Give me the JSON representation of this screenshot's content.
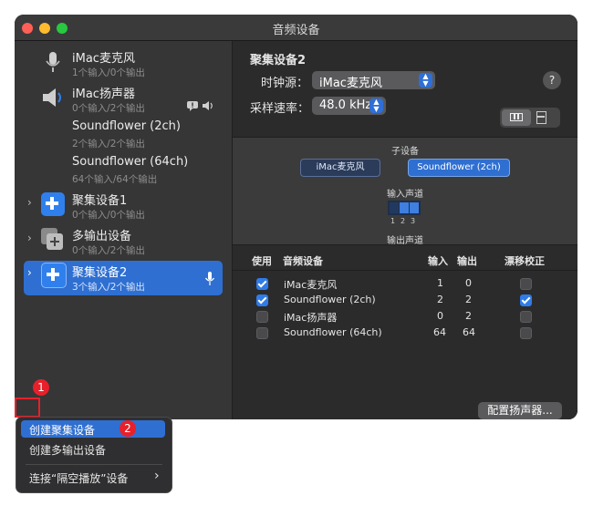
{
  "window": {
    "title": "音频设备"
  },
  "sidebar": {
    "devices": [
      {
        "name": "iMac麦克风",
        "sub": "1个输入/0个输出",
        "icon": "microphone-icon"
      },
      {
        "name": "iMac扬声器",
        "sub": "0个输入/2个输出",
        "icon": "speaker-icon"
      },
      {
        "name": "Soundflower (2ch)",
        "sub": "2个输入/2个输出"
      },
      {
        "name": "Soundflower (64ch)",
        "sub": "64个输入/64个输出"
      },
      {
        "name": "聚集设备1",
        "sub": "0个输入/0个输出",
        "icon": "aggregate-device-icon"
      },
      {
        "name": "多输出设备",
        "sub": "0个输入/2个输出",
        "icon": "multi-output-device-icon"
      },
      {
        "name": "聚集设备2",
        "sub": "3个输入/2个输出",
        "icon": "aggregate-device-icon",
        "selected": true
      }
    ],
    "bottom_bar": {
      "add": "+",
      "remove": "—",
      "gear": "⚙",
      "chevron": "⌄"
    }
  },
  "detail": {
    "device_title": "聚集设备2",
    "clock_label": "时钟源：",
    "clock_value": "iMac麦克风",
    "rate_label": "采样速率：",
    "rate_value": "48.0 kHz",
    "help": "?",
    "diagram": {
      "subdevice_title": "子设备",
      "chips": [
        "iMac麦克风",
        "Soundflower (2ch)"
      ],
      "input_label": "输入声道",
      "channel_numbers": [
        "1",
        "2",
        "3"
      ],
      "output_label": "输出声道"
    },
    "table": {
      "headers": [
        "使用",
        "音频设备",
        "输入",
        "输出",
        "漂移校正"
      ],
      "rows": [
        {
          "use": true,
          "device": "iMac麦克风",
          "in": "1",
          "out": "0",
          "drift": false
        },
        {
          "use": true,
          "device": "Soundflower (2ch)",
          "in": "2",
          "out": "2",
          "drift": true
        },
        {
          "use": false,
          "device": "iMac扬声器",
          "in": "0",
          "out": "2",
          "drift": false
        },
        {
          "use": false,
          "device": "Soundflower (64ch)",
          "in": "64",
          "out": "64",
          "drift": false
        }
      ]
    },
    "configure_button": "配置扬声器..."
  },
  "menu": {
    "items": [
      "创建聚集设备",
      "创建多输出设备",
      "连接“隔空播放”设备"
    ],
    "submenu_arrow": "›"
  },
  "annotations": {
    "badge1": "1",
    "badge2": "2",
    "highlight_color": "#e8202a"
  }
}
